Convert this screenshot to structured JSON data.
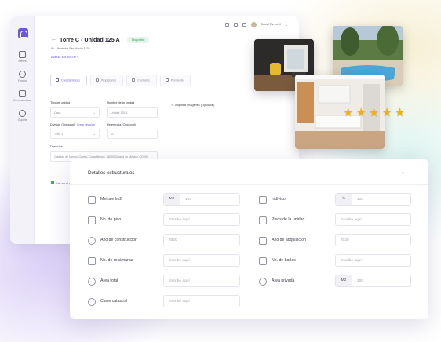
{
  "app": {
    "sidebar": [
      {
        "label": "Bienes",
        "icon": "building-icon"
      },
      {
        "label": "Fondos",
        "icon": "dollar-icon"
      },
      {
        "label": "Dimensionistas",
        "icon": "people-icon"
      },
      {
        "label": "Soporte",
        "icon": "headset-icon"
      }
    ],
    "user_name": "Daniel Torres M",
    "unit_title": "Torre C - Unidad 125 A",
    "status": "Disponible",
    "address": "Av. Libertador San Martín 1234",
    "price": "Avaluo: $ 5,500.00",
    "tabs": [
      "Características",
      "Propietarios",
      "Contratos",
      "Pendiente"
    ],
    "form": {
      "tipo_label": "Tipo de unidad",
      "tipo_value": "Casa",
      "nombre_label": "Nombre de la unidad",
      "nombre_value": "Unidad 125 A",
      "division_label": "División (Opcional)",
      "division_link": "Crear división",
      "division_value": "Torre 1",
      "referencia_label": "Referencia (Opcional)",
      "referencia_value": "1C",
      "direccion_label": "Dirección",
      "direccion_value": "Calzada de Mexico Centro, Cuauhtémoc, 06000 Ciudad de México, CDMX"
    },
    "attach_label": "Adjuntar imagenes (Opcional)",
    "map_link": "Ver en el mapa"
  },
  "rating_stars": 5,
  "card": {
    "title": "Detalles estructurales",
    "left": [
      {
        "label": "Metraje lm2",
        "icon": "ruler-icon",
        "unit": "M2",
        "value": "100"
      },
      {
        "label": "No. de piso",
        "icon": "floors-icon",
        "value": "Escribe aquí"
      },
      {
        "label": "Año de construcción",
        "icon": "hammer-icon",
        "value": "2020"
      },
      {
        "label": "No. de recámaras",
        "icon": "bed-icon",
        "value": "Escribe aquí"
      },
      {
        "label": "Área total",
        "icon": "house-icon",
        "value": "Escribe aquí"
      },
      {
        "label": "Clave catastral",
        "icon": "compass-icon",
        "value": "Escribe aquí"
      }
    ],
    "right": [
      {
        "label": "Indiviso",
        "icon": "grid-icon",
        "unit": "%",
        "value": "100"
      },
      {
        "label": "Pisos de la unidad",
        "icon": "stairs-icon",
        "value": "Escribe aquí"
      },
      {
        "label": "Año de adquisición",
        "icon": "handshake-icon",
        "value": "2020"
      },
      {
        "label": "No. de baños",
        "icon": "bath-icon",
        "value": "Escribe aquí"
      },
      {
        "label": "Área privada",
        "icon": "location-icon",
        "unit": "M2",
        "value": "100"
      }
    ]
  }
}
